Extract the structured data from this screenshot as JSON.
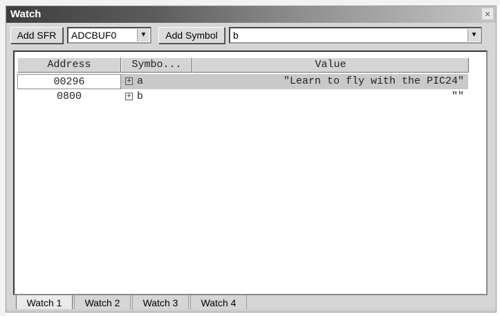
{
  "window": {
    "title": "Watch",
    "close_label": "×"
  },
  "toolbar": {
    "add_sfr_label": "Add SFR",
    "sfr_select_value": "ADCBUF0",
    "add_symbol_label": "Add Symbol",
    "symbol_select_value": "b",
    "dropdown_glyph": "▼"
  },
  "table": {
    "headers": {
      "address": "Address",
      "symbol": "Symbo...",
      "value": "Value"
    },
    "rows": [
      {
        "address": "00296",
        "symbol": "a",
        "value": "\"Learn to fly with the PIC24\""
      },
      {
        "address": "0800",
        "symbol": "b",
        "value": "\"\""
      }
    ],
    "expander_glyph": "+"
  },
  "tabs": [
    "Watch 1",
    "Watch 2",
    "Watch 3",
    "Watch 4"
  ]
}
